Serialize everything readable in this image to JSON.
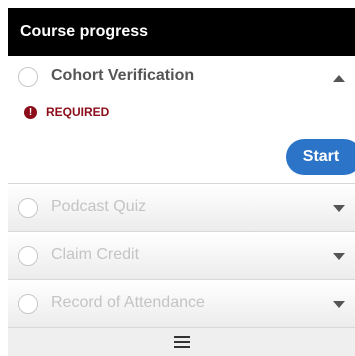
{
  "header": {
    "title": "Course progress"
  },
  "items": [
    {
      "title": "Cohort Verification",
      "expanded": true,
      "status_icon": "exclamation-icon",
      "status_label": "REQUIRED",
      "action_label": "Start"
    },
    {
      "title": "Podcast Quiz",
      "expanded": false
    },
    {
      "title": "Claim Credit",
      "expanded": false
    },
    {
      "title": "Record of Attendance",
      "expanded": false
    }
  ],
  "footer": {
    "icon": "hamburger-menu-icon"
  },
  "colors": {
    "header_bg": "#000000",
    "required": "#8b0d1a",
    "button": "#2c74c7"
  }
}
